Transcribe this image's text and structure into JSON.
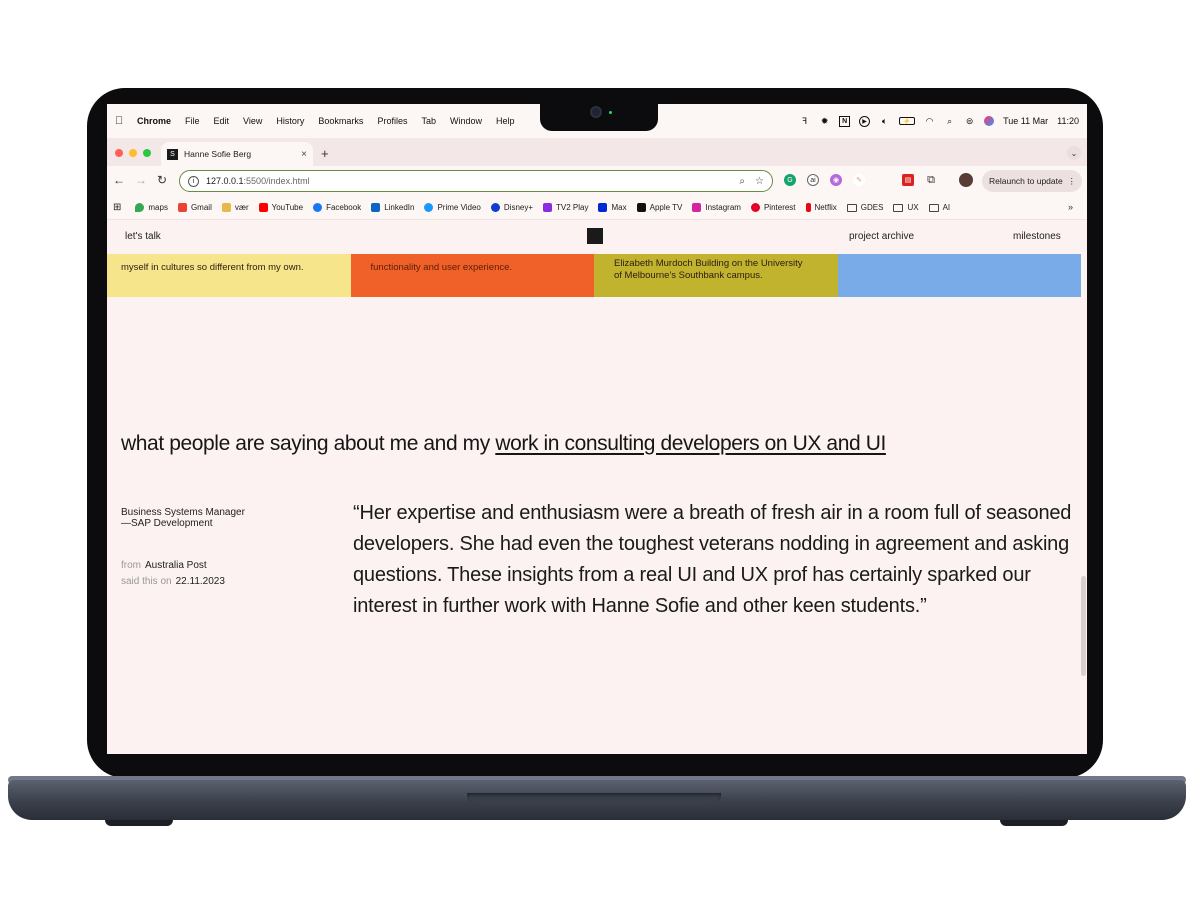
{
  "menubar": {
    "app": "Chrome",
    "items": [
      "File",
      "Edit",
      "View",
      "History",
      "Bookmarks",
      "Profiles",
      "Tab",
      "Window",
      "Help"
    ],
    "date": "Tue 11 Mar",
    "time": "11:20"
  },
  "tab": {
    "title": "Hanne Sofie Berg",
    "favicon_text": "S",
    "close": "×",
    "new_tab": "+"
  },
  "toolbar": {
    "url_host": "127.0.0.1",
    "url_rest": ":5500/index.html",
    "relaunch": "Relaunch to update"
  },
  "bookmarks": [
    {
      "label": "maps",
      "color": "#34a853"
    },
    {
      "label": "Gmail",
      "color": "#ea4335"
    },
    {
      "label": "vær",
      "color": "#e8b84a"
    },
    {
      "label": "YouTube",
      "color": "#ff0000"
    },
    {
      "label": "Facebook",
      "color": "#1877f2"
    },
    {
      "label": "LinkedIn",
      "color": "#0a66c2"
    },
    {
      "label": "Prime Video",
      "color": "#1a98ff"
    },
    {
      "label": "Disney+",
      "color": "#113ccf"
    },
    {
      "label": "TV2 Play",
      "color": "#8b2be2"
    },
    {
      "label": "Max",
      "color": "#0028d3"
    },
    {
      "label": "Apple TV",
      "color": "#111111"
    },
    {
      "label": "Instagram",
      "color": "#d6249f"
    },
    {
      "label": "Pinterest",
      "color": "#e60023"
    },
    {
      "label": "Netflix",
      "color": "#e50914"
    }
  ],
  "bookmark_folders": [
    "GDES",
    "UX",
    "AI"
  ],
  "page": {
    "nav_left": "let's talk",
    "nav_archive": "project archive",
    "nav_milestones": "milestones",
    "card1": "myself in cultures so different from my own.",
    "card2": "functionality and user experience.",
    "card3_l1": "Elizabeth Murdoch Building on the University",
    "card3_l2": "of Melbourne's Southbank campus.",
    "heading_plain": "what people are saying about me and my ",
    "heading_link": "work in consulting developers on UX and UI",
    "role_l1": "Business Systems Manager",
    "role_l2": "—SAP Development",
    "from_label": "from",
    "from_value": "Australia Post",
    "said_label": "said this on",
    "said_value": "22.11.2023",
    "quote": "“Her expertise and enthusiasm were a breath of fresh air in a room full of seasoned developers. She had even the toughest veterans nodding in agreement and asking questions. These insights from a real UI and UX prof has certainly sparked our interest in further work with Hanne Sofie and other keen students.”"
  },
  "colors": {
    "card_yellow": "#f6e58b",
    "card_orange": "#ef6128",
    "card_olive": "#c2b32f",
    "card_blue": "#7aabe9",
    "page_bg": "#fcf2f1"
  }
}
